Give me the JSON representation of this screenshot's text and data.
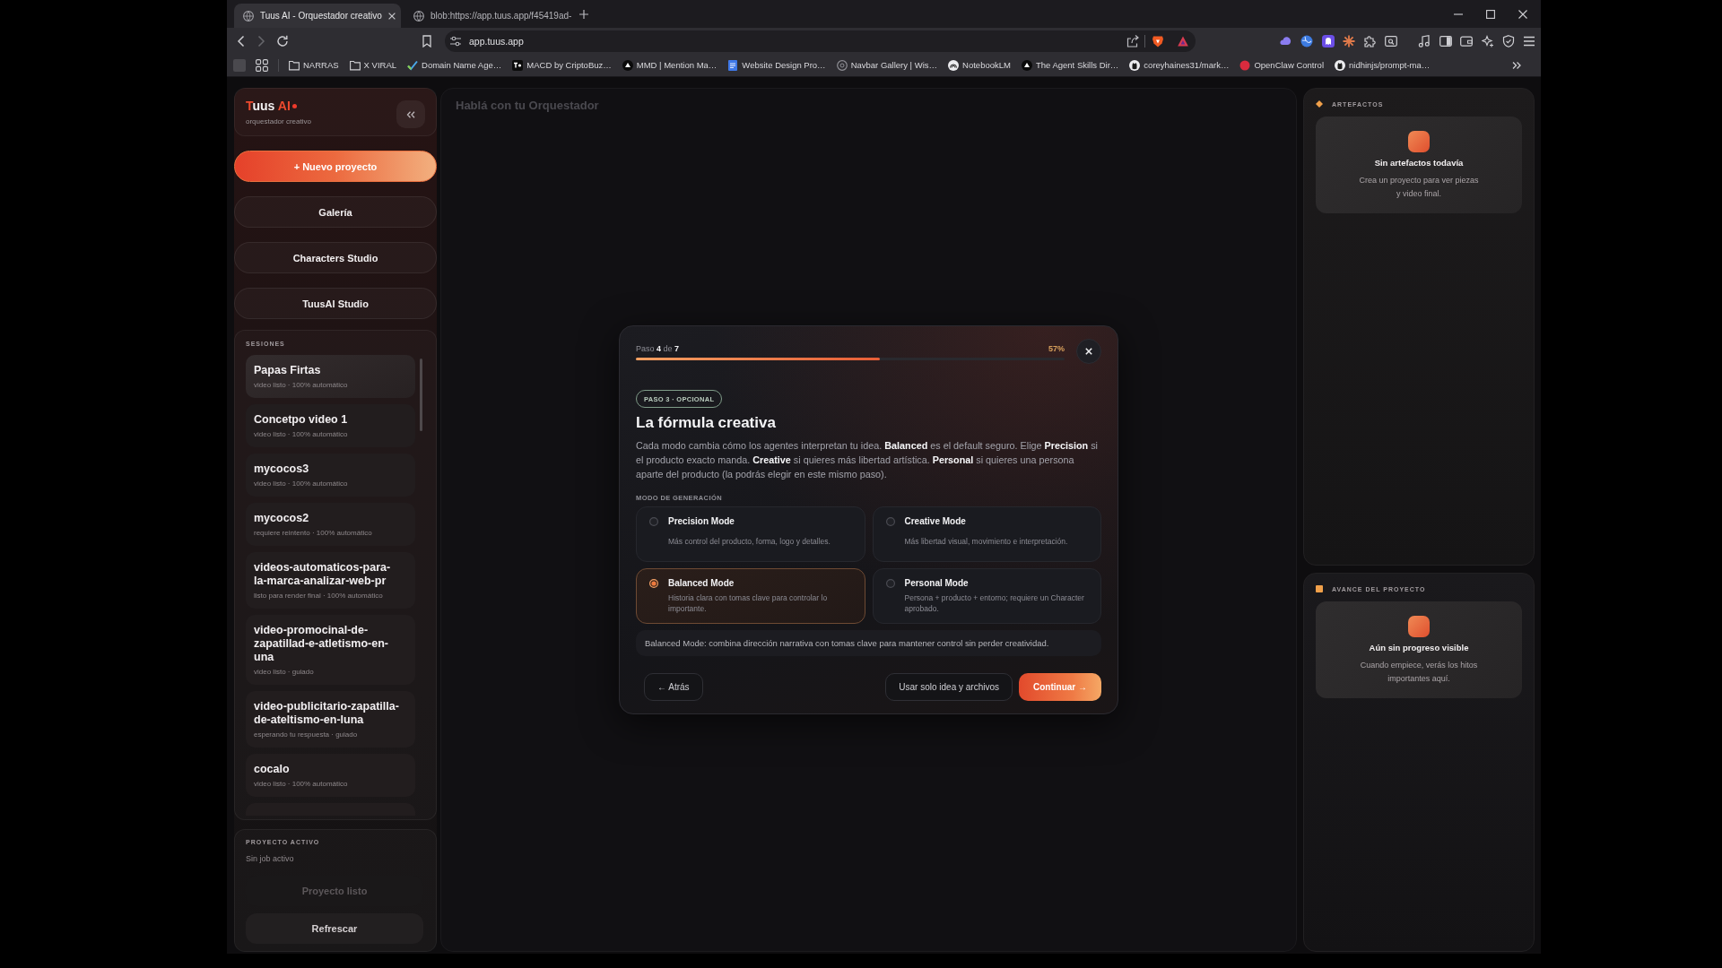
{
  "browser": {
    "tabs": [
      {
        "title": "Tuus AI - Orquestador creativo",
        "selected": true
      },
      {
        "title": "blob:https://app.tuus.app/f45419ad-",
        "selected": false
      }
    ],
    "address": "app.tuus.app",
    "bookmarks": [
      {
        "kind": "folder",
        "label": "NARRAS"
      },
      {
        "kind": "folder",
        "label": "X VIRAL"
      },
      {
        "kind": "link",
        "label": "Domain Name Age…"
      },
      {
        "kind": "link",
        "label": "MACD by CriptoBuz…"
      },
      {
        "kind": "link",
        "label": "MMD | Mention Ma…"
      },
      {
        "kind": "link",
        "label": "Website Design Pro…"
      },
      {
        "kind": "link",
        "label": "Navbar Gallery | Wis…"
      },
      {
        "kind": "link",
        "label": "NotebookLM"
      },
      {
        "kind": "link",
        "label": "The Agent Skills Dir…"
      },
      {
        "kind": "link",
        "label": "coreyhaines31/mark…"
      },
      {
        "kind": "link",
        "label": "OpenClaw Control"
      },
      {
        "kind": "link",
        "label": "nidhinjs/prompt-ma…"
      }
    ]
  },
  "sidebar": {
    "logo": [
      {
        "text": "T",
        "accent": true
      },
      {
        "text": "uus ",
        "accent": false
      },
      {
        "text": "AI",
        "accent": true
      }
    ],
    "tagline": "orquestador creativo",
    "nav": [
      {
        "label": "+ Nuevo proyecto",
        "kind": "primary"
      },
      {
        "label": "Galería",
        "kind": "secondary"
      },
      {
        "label": "Characters Studio",
        "kind": "secondary"
      },
      {
        "label": "TuusAI Studio",
        "kind": "secondary"
      }
    ],
    "sessions": {
      "title": "SESIONES",
      "items": [
        {
          "name": "Papas Firtas",
          "status": "video listo · 100% automático",
          "selected": true
        },
        {
          "name": "Concetpo video 1",
          "status": "video listo · 100% automático",
          "selected": false
        },
        {
          "name": "mycocos3",
          "status": "video listo · 100% automático",
          "selected": false
        },
        {
          "name": "mycocos2",
          "status": "requiere reintento · 100% automático",
          "selected": false
        },
        {
          "name": "videos-automaticos-para-la-marca-analizar-web-pr",
          "status": "listo para render final · 100% automático",
          "selected": false
        },
        {
          "name": "video-promocinal-de-zapatillad-e-atletismo-en-una",
          "status": "video listo · guiado",
          "selected": false
        },
        {
          "name": "video-publicitario-zapatilla-de-ateltismo-en-luna",
          "status": "esperando tu respuesta · guiado",
          "selected": false
        },
        {
          "name": "cocalo",
          "status": "video listo · 100% automático",
          "selected": false
        }
      ]
    },
    "active_project": {
      "title": "PROYECTO ACTIVO",
      "status": "Sin job activo",
      "buttons": [
        {
          "label": "Proyecto listo",
          "disabled": true
        },
        {
          "label": "Refrescar",
          "disabled": false
        }
      ]
    }
  },
  "main": {
    "title": "Hablá con tu Orquestador"
  },
  "modal": {
    "step": "Paso **4** de **7**",
    "progress": {
      "level": 0.57,
      "percent": "57%"
    },
    "badge": "PASO 3 · OPCIONAL",
    "title": "La fórmula creativa",
    "description": "Cada modo cambia cómo los agentes interpretan tu idea. **Balanced** es el default seguro. Elige **Precision** si el producto exacto manda. **Creative** si quieres más libertad artística. **Personal** si quieres una persona aparte del producto (la podrás elegir en este mismo paso).",
    "section_label": "MODO DE GENERACIÓN",
    "modes": [
      {
        "name": "Precision Mode",
        "description": "Más control del producto, forma, logo y detalles.",
        "selected": false
      },
      {
        "name": "Creative Mode",
        "description": "Más libertad visual, movimiento e interpretación.",
        "selected": false
      },
      {
        "name": "Balanced Mode",
        "description": "Historia clara con tomas clave para controlar lo importante.",
        "selected": true
      },
      {
        "name": "Personal Mode",
        "description": "Persona + producto + entorno; requiere un Character aprobado.",
        "selected": false
      }
    ],
    "note": "Balanced Mode: combina dirección narrativa con tomas clave para mantener control sin perder creatividad.",
    "actions": [
      {
        "label": "← Atrás",
        "kind": "back"
      },
      {
        "label": "Usar solo idea y archivos",
        "kind": "secondary"
      },
      {
        "label": "Continuar →",
        "kind": "primary"
      }
    ]
  },
  "right": {
    "artifacts": {
      "title": "ARTEFACTOS",
      "empty_title": "Sin artefactos todavía",
      "empty_text": "Crea un proyecto para ver piezas y video final."
    },
    "progress": {
      "title": "AVANCE DEL PROYECTO",
      "empty_title": "Aún sin progreso visible",
      "empty_text": "Cuando empiece, verás los hitos importantes aquí."
    }
  }
}
